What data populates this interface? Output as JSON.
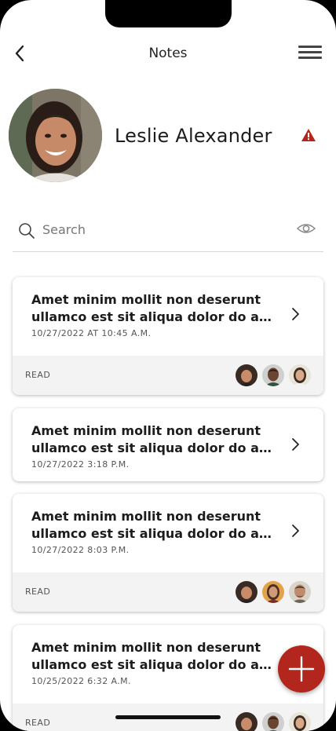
{
  "header": {
    "title": "Notes"
  },
  "profile": {
    "name": "Leslie Alexander"
  },
  "search": {
    "placeholder": "Search"
  },
  "notes": [
    {
      "title_line1": "Amet minim mollit non deserunt",
      "title_line2": "ullamco est sit aliqua dolor do amet...",
      "date": "10/27/2022 AT 10:45 A.M.",
      "status": "READ"
    },
    {
      "title_line1": "Amet minim mollit non deserunt",
      "title_line2": "ullamco est sit aliqua dolor do amet...",
      "date": "10/27/2022 3:18 P.M."
    },
    {
      "title_line1": "Amet minim mollit non deserunt",
      "title_line2": "ullamco est sit aliqua dolor do amet...",
      "date": "10/27/2022 8:03 P.M.",
      "status": "READ"
    },
    {
      "title_line1": "Amet minim mollit non deserunt",
      "title_line2": "ullamco est sit aliqua dolor do amet...",
      "date": "10/25/2022 6:32 A.M.",
      "status": "READ"
    }
  ],
  "colors": {
    "accent": "#b3261e",
    "alert": "#b3261e",
    "card_footer": "#f3f3f3"
  },
  "icons": {
    "back": "back-arrow-icon",
    "menu": "hamburger-menu-icon",
    "alert": "warning-triangle-icon",
    "search": "search-icon",
    "visibility": "eye-icon",
    "chevron": "chevron-right-icon",
    "add": "plus-icon"
  }
}
